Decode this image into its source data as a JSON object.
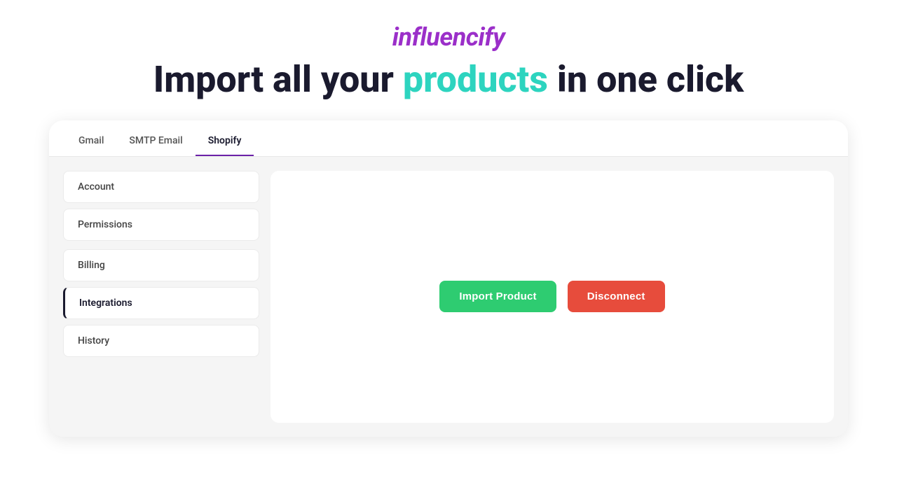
{
  "logo": {
    "text": "influencify"
  },
  "hero": {
    "prefix": "Import all your ",
    "highlight": "products",
    "suffix": " in one click"
  },
  "tabs": [
    {
      "id": "gmail",
      "label": "Gmail",
      "active": false
    },
    {
      "id": "smtp-email",
      "label": "SMTP Email",
      "active": false
    },
    {
      "id": "shopify",
      "label": "Shopify",
      "active": true
    }
  ],
  "sidebar": {
    "items_top": [
      {
        "id": "account",
        "label": "Account",
        "active": false
      },
      {
        "id": "permissions",
        "label": "Permissions",
        "active": false
      }
    ],
    "items_middle": [
      {
        "id": "billing",
        "label": "Billing",
        "active": false
      }
    ],
    "items_bottom": [
      {
        "id": "integrations",
        "label": "Integrations",
        "active": true
      },
      {
        "id": "history",
        "label": "History",
        "active": false
      }
    ]
  },
  "buttons": {
    "import": "Import Product",
    "disconnect": "Disconnect"
  }
}
